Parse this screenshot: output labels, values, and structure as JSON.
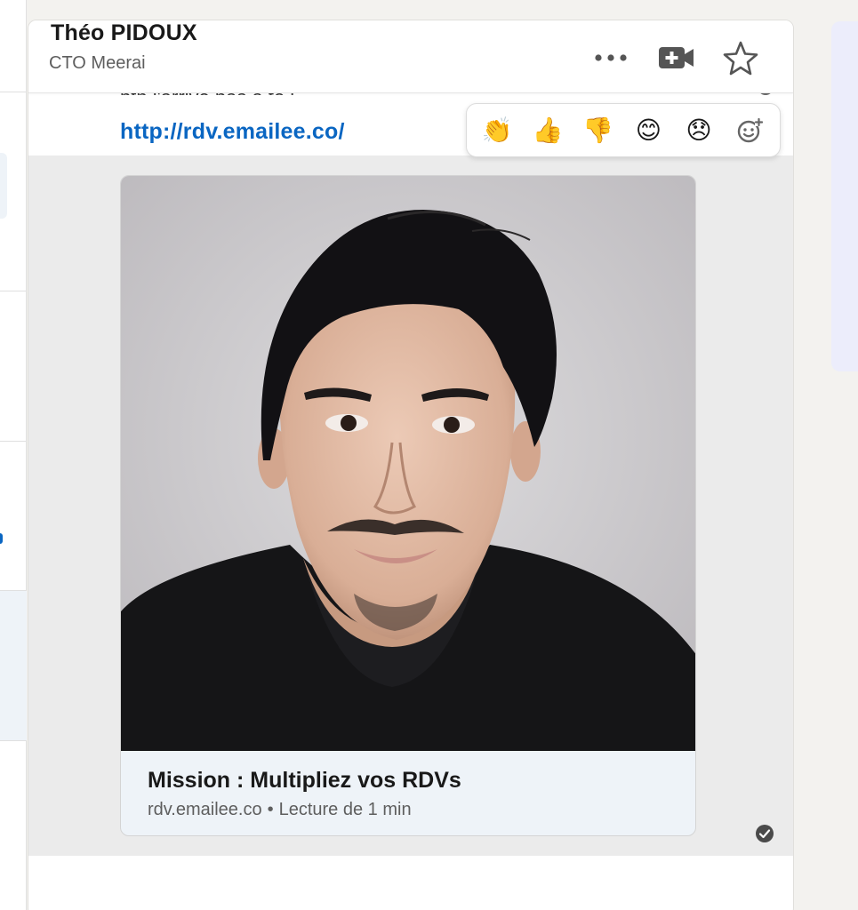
{
  "header": {
    "name": "Théo PIDOUX",
    "subtitle": "CTO Meerai",
    "icons": [
      "more-icon",
      "video-call-icon",
      "star-icon"
    ]
  },
  "messages": {
    "previous_text_partial": "ptn j'arrive pas à te j",
    "link": "http://rdv.emailee.co/"
  },
  "reactions": [
    {
      "name": "clap",
      "glyph": "👏"
    },
    {
      "name": "thumbs-up",
      "glyph": "👍"
    },
    {
      "name": "thumbs-down",
      "glyph": "👎"
    },
    {
      "name": "smile",
      "glyph": "😊"
    },
    {
      "name": "disappointed",
      "glyph": "😞"
    },
    {
      "name": "add-reaction",
      "glyph": "add-reaction-icon"
    }
  ],
  "preview": {
    "title": "Mission : Multipliez vos RDVs",
    "domain": "rdv.emailee.co",
    "separator": "•",
    "read_time": "Lecture de 1 min"
  },
  "colors": {
    "link": "#0a66c2",
    "highlight_bg": "#ebebeb",
    "preview_footer": "#eef3f8"
  }
}
